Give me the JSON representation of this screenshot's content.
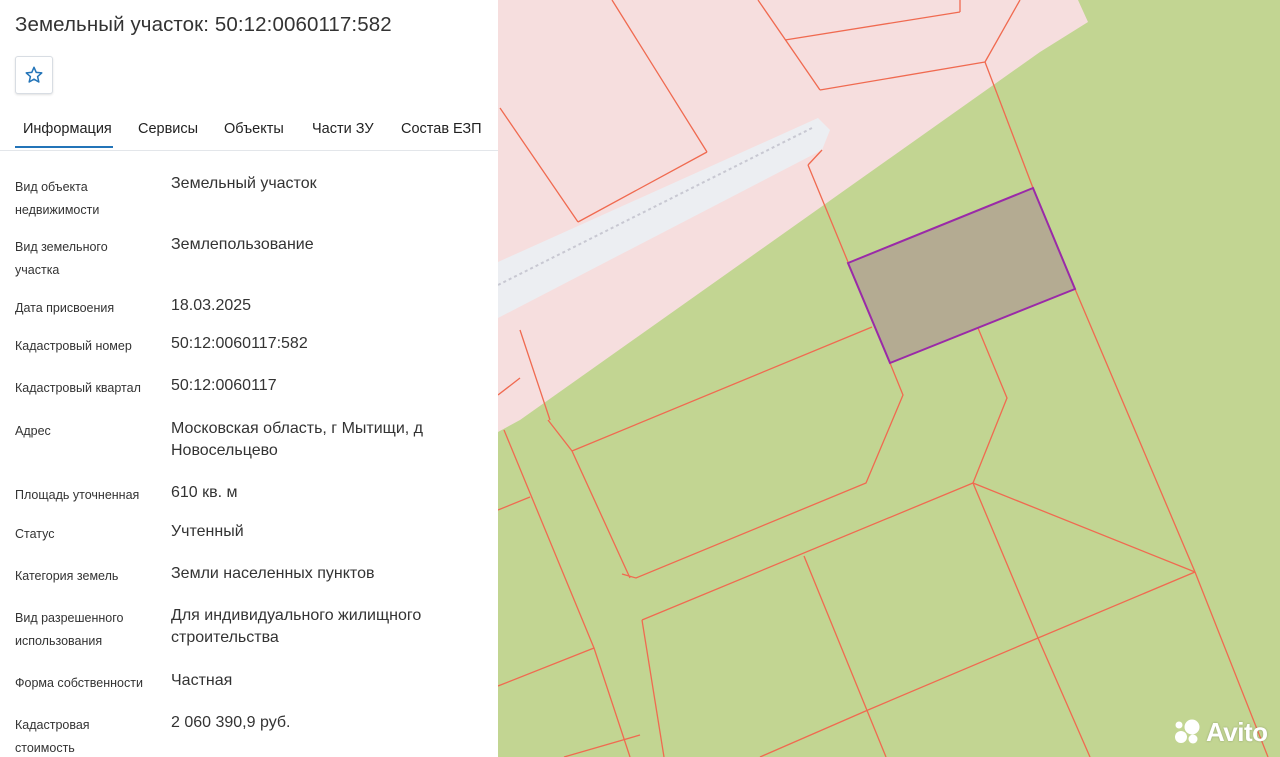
{
  "header": {
    "title": "Земельный участок: 50:12:0060117:582"
  },
  "favorite": {
    "icon": "star-outline-icon"
  },
  "tabs": [
    {
      "label": "Информация",
      "active": true
    },
    {
      "label": "Сервисы",
      "active": false
    },
    {
      "label": "Объекты",
      "active": false
    },
    {
      "label": "Части ЗУ",
      "active": false
    },
    {
      "label": "Состав ЕЗП",
      "active": false
    }
  ],
  "info": [
    {
      "label": "Вид объекта недвижимости",
      "value": "Земельный участок"
    },
    {
      "label": "Вид земельного участка",
      "value": "Землепользование"
    },
    {
      "label": "Дата присвоения",
      "value": "18.03.2025"
    },
    {
      "label": "Кадастровый номер",
      "value": "50:12:0060117:582"
    },
    {
      "label": "Кадастровый квартал",
      "value": "50:12:0060117"
    },
    {
      "label": "Адрес",
      "value": "Московская область, г Мытищи, д Новосельцево"
    },
    {
      "label": "Площадь уточненная",
      "value": "610 кв. м"
    },
    {
      "label": "Статус",
      "value": "Учтенный"
    },
    {
      "label": "Категория земель",
      "value": "Земли населенных пунктов"
    },
    {
      "label": "Вид разрешенного использования",
      "value": "Для индивидуального жилищного строительства"
    },
    {
      "label": "Форма собственности",
      "value": "Частная"
    },
    {
      "label": "Кадастровая стоимость",
      "value": "2 060 390,9 руб."
    }
  ],
  "watermark": {
    "text": "Avito",
    "icon": "avito-logo-icon"
  },
  "colors": {
    "accent": "#2374b8",
    "map_green": "#c2d592",
    "map_pink": "#f6dede",
    "parcel_border": "#f06a50",
    "selected_fill": "#b4ab92",
    "selected_border": "#9a2aa8"
  }
}
